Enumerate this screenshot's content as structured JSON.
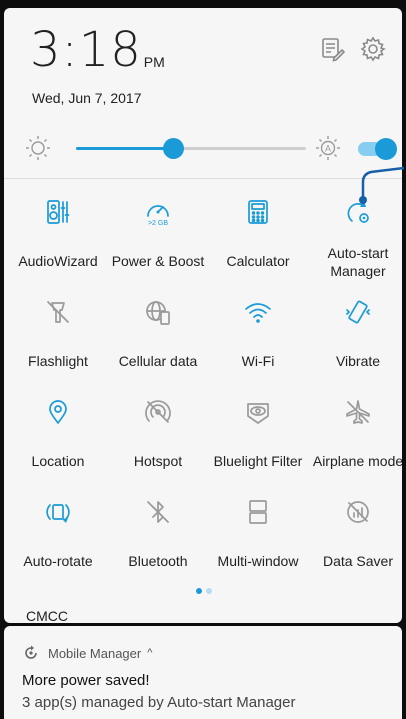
{
  "status": {
    "time": "3:18",
    "ampm": "PM",
    "date": "Wed, Jun 7, 2017"
  },
  "header_icons": [
    "edit-tiles-icon",
    "gear-icon"
  ],
  "brightness": {
    "level": 0.42,
    "auto_label": "A",
    "auto_enabled": true
  },
  "tiles": [
    {
      "label": "AudioWizard",
      "icon": "audiowizard-icon",
      "active": true
    },
    {
      "label": "Power & Boost",
      "icon": "power-boost-icon",
      "active": true,
      "badge": ">2 GB"
    },
    {
      "label": "Calculator",
      "icon": "calculator-icon",
      "active": true
    },
    {
      "label": "Auto-start\nManager",
      "icon": "autostart-manager-icon",
      "active": true
    },
    {
      "label": "Flashlight",
      "icon": "flashlight-icon",
      "active": false
    },
    {
      "label": "Cellular data",
      "icon": "cellular-data-icon",
      "active": false
    },
    {
      "label": "Wi-Fi",
      "icon": "wifi-icon",
      "active": true
    },
    {
      "label": "Vibrate",
      "icon": "vibrate-icon",
      "active": true
    },
    {
      "label": "Location",
      "icon": "location-icon",
      "active": true
    },
    {
      "label": "Hotspot",
      "icon": "hotspot-icon",
      "active": false
    },
    {
      "label": "Bluelight Filter",
      "icon": "bluelight-filter-icon",
      "active": false
    },
    {
      "label": "Airplane mode",
      "icon": "airplane-icon",
      "active": false
    },
    {
      "label": "Auto-rotate",
      "icon": "auto-rotate-icon",
      "active": true
    },
    {
      "label": "Bluetooth",
      "icon": "bluetooth-icon",
      "active": false
    },
    {
      "label": "Multi-window",
      "icon": "multi-window-icon",
      "active": false
    },
    {
      "label": "Data Saver",
      "icon": "data-saver-icon",
      "active": false
    }
  ],
  "pager": {
    "pages": 2,
    "current": 1
  },
  "carrier": "CMCC",
  "notification": {
    "app": "Mobile Manager",
    "expand_glyph": "^",
    "title": "More power saved!",
    "body": "3 app(s) managed by Auto-start Manager"
  },
  "colors": {
    "accent": "#1a9bd8",
    "inactive": "#9a9a9a",
    "panel": "#f6f6f6"
  }
}
